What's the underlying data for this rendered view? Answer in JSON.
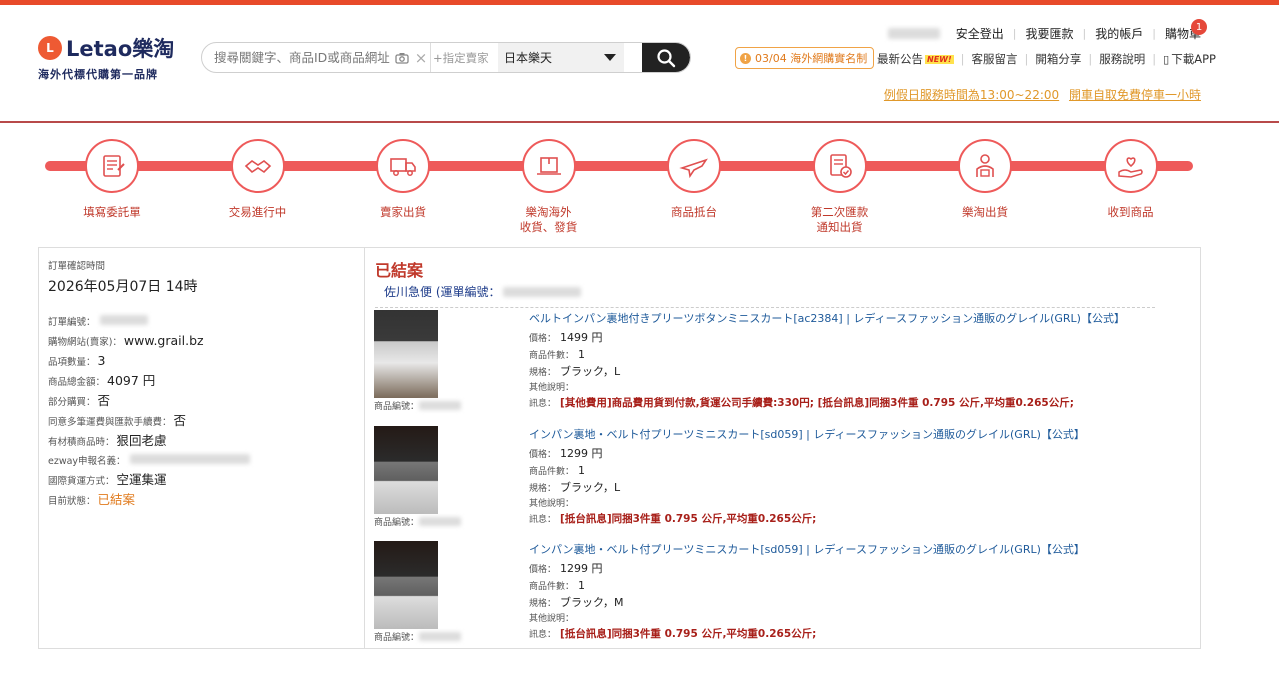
{
  "header": {
    "logo_text": "Letao樂淘",
    "logo_tagline": "海外代標代購第一品牌",
    "search_placeholder": "搜尋關鍵字、商品ID或商品網址",
    "seller_placeholder": "+指定賣家",
    "site_select": "日本樂天",
    "top_links": [
      "安全登出",
      "我要匯款",
      "我的帳戶",
      "購物車"
    ],
    "cart_count": "1",
    "notice": "03/04 海外網購實名制",
    "sub_links": [
      "最新公告",
      "客服留言",
      "開箱分享",
      "服務說明",
      "下載APP"
    ],
    "new_badge": "NEW!",
    "promo_hours": "例假日服務時間為13:00~22:00",
    "promo_parking": "開車自取免費停車一小時"
  },
  "steps": [
    {
      "label": "填寫委託單",
      "icon": "form-icon"
    },
    {
      "label": "交易進行中",
      "icon": "handshake-icon"
    },
    {
      "label": "賣家出貨",
      "icon": "truck-icon"
    },
    {
      "label": "樂淘海外\n收貨、發貨",
      "icon": "package-icon"
    },
    {
      "label": "商品抵台",
      "icon": "airplane-icon"
    },
    {
      "label": "第二次匯款\n通知出貨",
      "icon": "invoice-icon"
    },
    {
      "label": "樂淘出貨",
      "icon": "courier-icon"
    },
    {
      "label": "收到商品",
      "icon": "heart-hand-icon"
    }
  ],
  "order": {
    "confirm_time_label": "訂單確認時間",
    "confirm_time": "2026年05月07日 14時",
    "fields": [
      {
        "label": "訂單編號：",
        "value": ""
      },
      {
        "label": "購物網站(賣家)：",
        "value": "www.grail.bz"
      },
      {
        "label": "品項數量：",
        "value": "3"
      },
      {
        "label": "商品總金額：",
        "value": "4097 円"
      },
      {
        "label": "部分購買：",
        "value": "否"
      },
      {
        "label": "同意多筆運費與匯款手續費：",
        "value": "否"
      },
      {
        "label": "有材積商品時：",
        "value": "狠回老慮"
      },
      {
        "label": "ezway申報名義：",
        "value": ""
      },
      {
        "label": "國際貨運方式：",
        "value": "空運集運"
      },
      {
        "label": "目前狀態：",
        "value": "已結案"
      }
    ]
  },
  "detail": {
    "status": "已結案",
    "carrier": "佐川急便 (運單編號：",
    "code_label": "商品編號：",
    "field_labels": {
      "price": "價格：",
      "qty": "商品件數：",
      "spec": "規格：",
      "other": "其他說明：",
      "msg": "訊息："
    },
    "items": [
      {
        "title": "ベルトインパン裏地付きプリーツボタンミニスカート[ac2384] | レディースファッション通販のグレイル(GRL)【公式】",
        "price": "1499 円",
        "qty": "1",
        "spec": "ブラック，L",
        "other": "",
        "msg": "[其他費用]商品費用貨到付款,貨運公司手續費:330円;  [抵台訊息]同捆3件重 0.795 公斤,平均重0.265公斤;"
      },
      {
        "title": "インパン裏地・ベルト付プリーツミニスカート[sd059] | レディースファッション通販のグレイル(GRL)【公式】",
        "price": "1299 円",
        "qty": "1",
        "spec": "ブラック，L",
        "other": "",
        "msg": "[抵台訊息]同捆3件重 0.795 公斤,平均重0.265公斤;"
      },
      {
        "title": "インパン裏地・ベルト付プリーツミニスカート[sd059] | レディースファッション通販のグレイル(GRL)【公式】",
        "price": "1299 円",
        "qty": "1",
        "spec": "ブラック，M",
        "other": "",
        "msg": "[抵台訊息]同捆3件重 0.795 公斤,平均重0.265公斤;"
      }
    ]
  },
  "colors": {
    "accent": "#ee5a5a",
    "brand_navy": "#1e2a5e",
    "status_orange": "#e07a1c",
    "link_blue": "#1e5a9a"
  }
}
